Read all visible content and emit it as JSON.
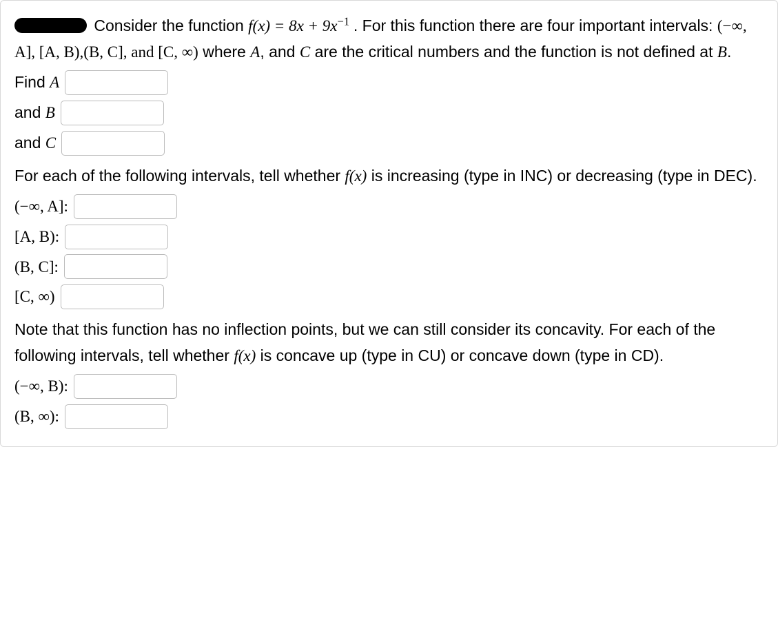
{
  "problem": {
    "intro1a": "Consider the function ",
    "func_lhs": "f(x) = 8x + 9x",
    "func_exp": "−1",
    "intro1b": " . For this function there are four important intervals: ",
    "intervals_text": "(−∞, A], [A, B),(B, C], and [C, ∞)",
    "intro1c": " where ",
    "A": "A",
    "intro1d": ", and ",
    "C": "C",
    "intro1e": " are the critical numbers and the function is not defined at ",
    "B": "B",
    "intro1f": "."
  },
  "find": {
    "A_label_pre": "Find ",
    "A_var": "A",
    "B_label_pre": "and ",
    "B_var": "B",
    "C_label_pre": "and ",
    "C_var": "C"
  },
  "incdec": {
    "para_a": "For each of the following intervals, tell whether ",
    "fx": "f(x)",
    "para_b": " is increasing (type in INC) or decreasing (type in DEC).",
    "int1": "(−∞, A]:",
    "int2": "[A, B):",
    "int3": "(B, C]:",
    "int4": "[C, ∞)"
  },
  "concavity": {
    "note_a": "Note that this function has no inflection points, but we can still consider its concavity. For each of the following intervals, tell whether ",
    "fx": "f(x)",
    "note_b": " is concave up (type in CU) or concave down (type in CD).",
    "int1": "(−∞, B):",
    "int2": "(B, ∞):"
  }
}
